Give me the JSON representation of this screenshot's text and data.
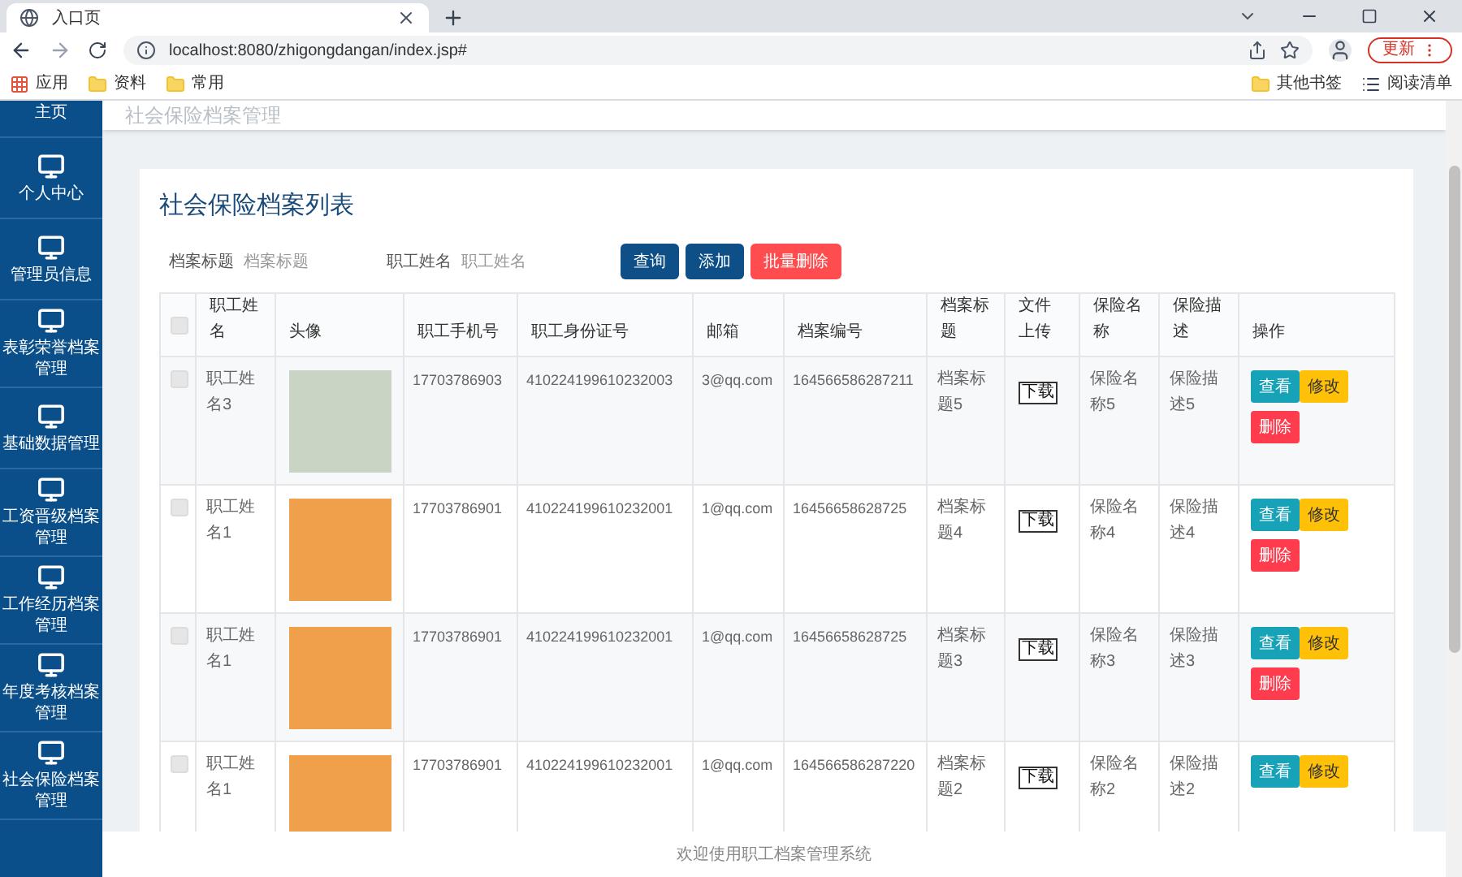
{
  "browser": {
    "tab_title": "入口页",
    "url": "localhost:8080/zhigongdangan/index.jsp#",
    "update_button": "更新",
    "bookmarks": [
      {
        "label": "应用",
        "kind": "apps"
      },
      {
        "label": "资料",
        "kind": "folder"
      },
      {
        "label": "常用",
        "kind": "folder"
      }
    ],
    "bookmarks_right": [
      {
        "label": "其他书签",
        "kind": "folder"
      },
      {
        "label": "阅读清单",
        "kind": "list"
      }
    ]
  },
  "sidebar": {
    "items": [
      {
        "label": "主页",
        "selected": false
      },
      {
        "label": "个人中心",
        "selected": false
      },
      {
        "label": "管理员信息",
        "selected": false
      },
      {
        "label": "表彰荣誉档案管理",
        "selected": false
      },
      {
        "label": "基础数据管理",
        "selected": false
      },
      {
        "label": "工资晋级档案管理",
        "selected": false
      },
      {
        "label": "工作经历档案管理",
        "selected": false
      },
      {
        "label": "年度考核档案管理",
        "selected": false
      },
      {
        "label": "社会保险档案管理",
        "selected": false
      }
    ]
  },
  "page_header": {
    "title": "社会保险档案管理"
  },
  "card": {
    "title": "社会保险档案列表"
  },
  "search": {
    "fields": [
      {
        "label": "档案标题",
        "placeholder": "档案标题"
      },
      {
        "label": "职工姓名",
        "placeholder": "职工姓名"
      }
    ],
    "buttons": [
      {
        "label": "查询",
        "kind": "primary"
      },
      {
        "label": "添加",
        "kind": "primary"
      },
      {
        "label": "批量删除",
        "kind": "danger"
      }
    ]
  },
  "table": {
    "select_all": {
      "checked": false
    },
    "columns": [
      "职工姓名",
      "头像",
      "职工手机号",
      "职工身份证号",
      "邮箱",
      "档案编号",
      "档案标题",
      "文件上传",
      "保险名称",
      "保险描述",
      "操作"
    ],
    "rows": [
      {
        "checked": false,
        "name": "职工姓名3",
        "avatar": {
          "kind": "photo"
        },
        "phone": "17703786903",
        "id_number": "410224199610232003",
        "email": "3@qq.com",
        "file_no": "164566586287211",
        "title": "档案标题5",
        "file": "下载",
        "insurance_name": "保险名称5",
        "insurance_desc": "保险描述5",
        "actions": [
          {
            "label": "查看",
            "kind": "view"
          },
          {
            "label": "修改",
            "kind": "edit"
          },
          {
            "label": "删除",
            "kind": "delete"
          }
        ]
      },
      {
        "checked": false,
        "name": "职工姓名1",
        "avatar": {
          "kind": "cartoon"
        },
        "phone": "17703786901",
        "id_number": "410224199610232001",
        "email": "1@qq.com",
        "file_no": "16456658628725",
        "title": "档案标题4",
        "file": "下载",
        "insurance_name": "保险名称4",
        "insurance_desc": "保险描述4",
        "actions": [
          {
            "label": "查看",
            "kind": "view"
          },
          {
            "label": "修改",
            "kind": "edit"
          },
          {
            "label": "删除",
            "kind": "delete"
          }
        ]
      },
      {
        "checked": false,
        "name": "职工姓名1",
        "avatar": {
          "kind": "cartoon"
        },
        "phone": "17703786901",
        "id_number": "410224199610232001",
        "email": "1@qq.com",
        "file_no": "16456658628725",
        "title": "档案标题3",
        "file": "下载",
        "insurance_name": "保险名称3",
        "insurance_desc": "保险描述3",
        "actions": [
          {
            "label": "查看",
            "kind": "view"
          },
          {
            "label": "修改",
            "kind": "edit"
          },
          {
            "label": "删除",
            "kind": "delete"
          }
        ]
      },
      {
        "checked": false,
        "name": "职工姓名1",
        "avatar": {
          "kind": "cartoon"
        },
        "phone": "17703786901",
        "id_number": "410224199610232001",
        "email": "1@qq.com",
        "file_no": "164566586287220",
        "title": "档案标题2",
        "file": "下载",
        "insurance_name": "保险名称2",
        "insurance_desc": "保险描述2",
        "actions": [
          {
            "label": "查看",
            "kind": "view"
          },
          {
            "label": "修改",
            "kind": "edit"
          }
        ]
      }
    ]
  },
  "footer": {
    "text": "欢迎使用职工档案管理系统"
  }
}
